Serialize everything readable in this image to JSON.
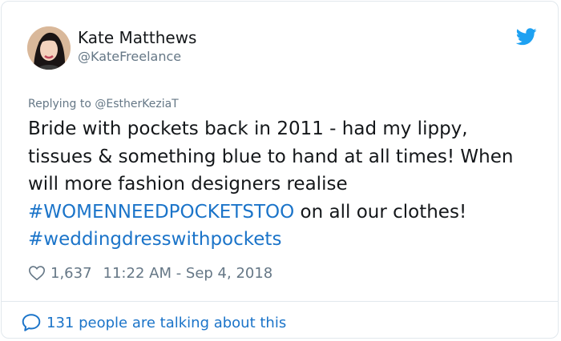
{
  "author": {
    "name": "Kate Matthews",
    "handle": "@KateFreelance"
  },
  "reply": {
    "prefix": "Replying to",
    "mention": "@EstherKeziaT"
  },
  "tweet": {
    "line1": "Bride with pockets back in 2011 - had my lippy,",
    "line2": "tissues & something blue to hand at all times! When",
    "line3": "will more fashion designers realise",
    "hashtag1": "#WOMENNEEDPOCKETSTOO",
    "line4_rest": " on all our clothes!",
    "hashtag2": "#weddingdresswithpockets"
  },
  "meta": {
    "likes": "1,637",
    "timestamp": "11:22 AM - Sep 4, 2018"
  },
  "footer": {
    "talking": "131 people are talking about this"
  },
  "icons": {
    "brand": "twitter-bird-icon",
    "like": "heart-icon",
    "conversation": "speech-bubble-icon"
  },
  "colors": {
    "link": "#1b74c9",
    "twitter_blue": "#1da1f2",
    "secondary_text": "#657786",
    "primary_text": "#14171a",
    "border": "#e1e8ed"
  }
}
